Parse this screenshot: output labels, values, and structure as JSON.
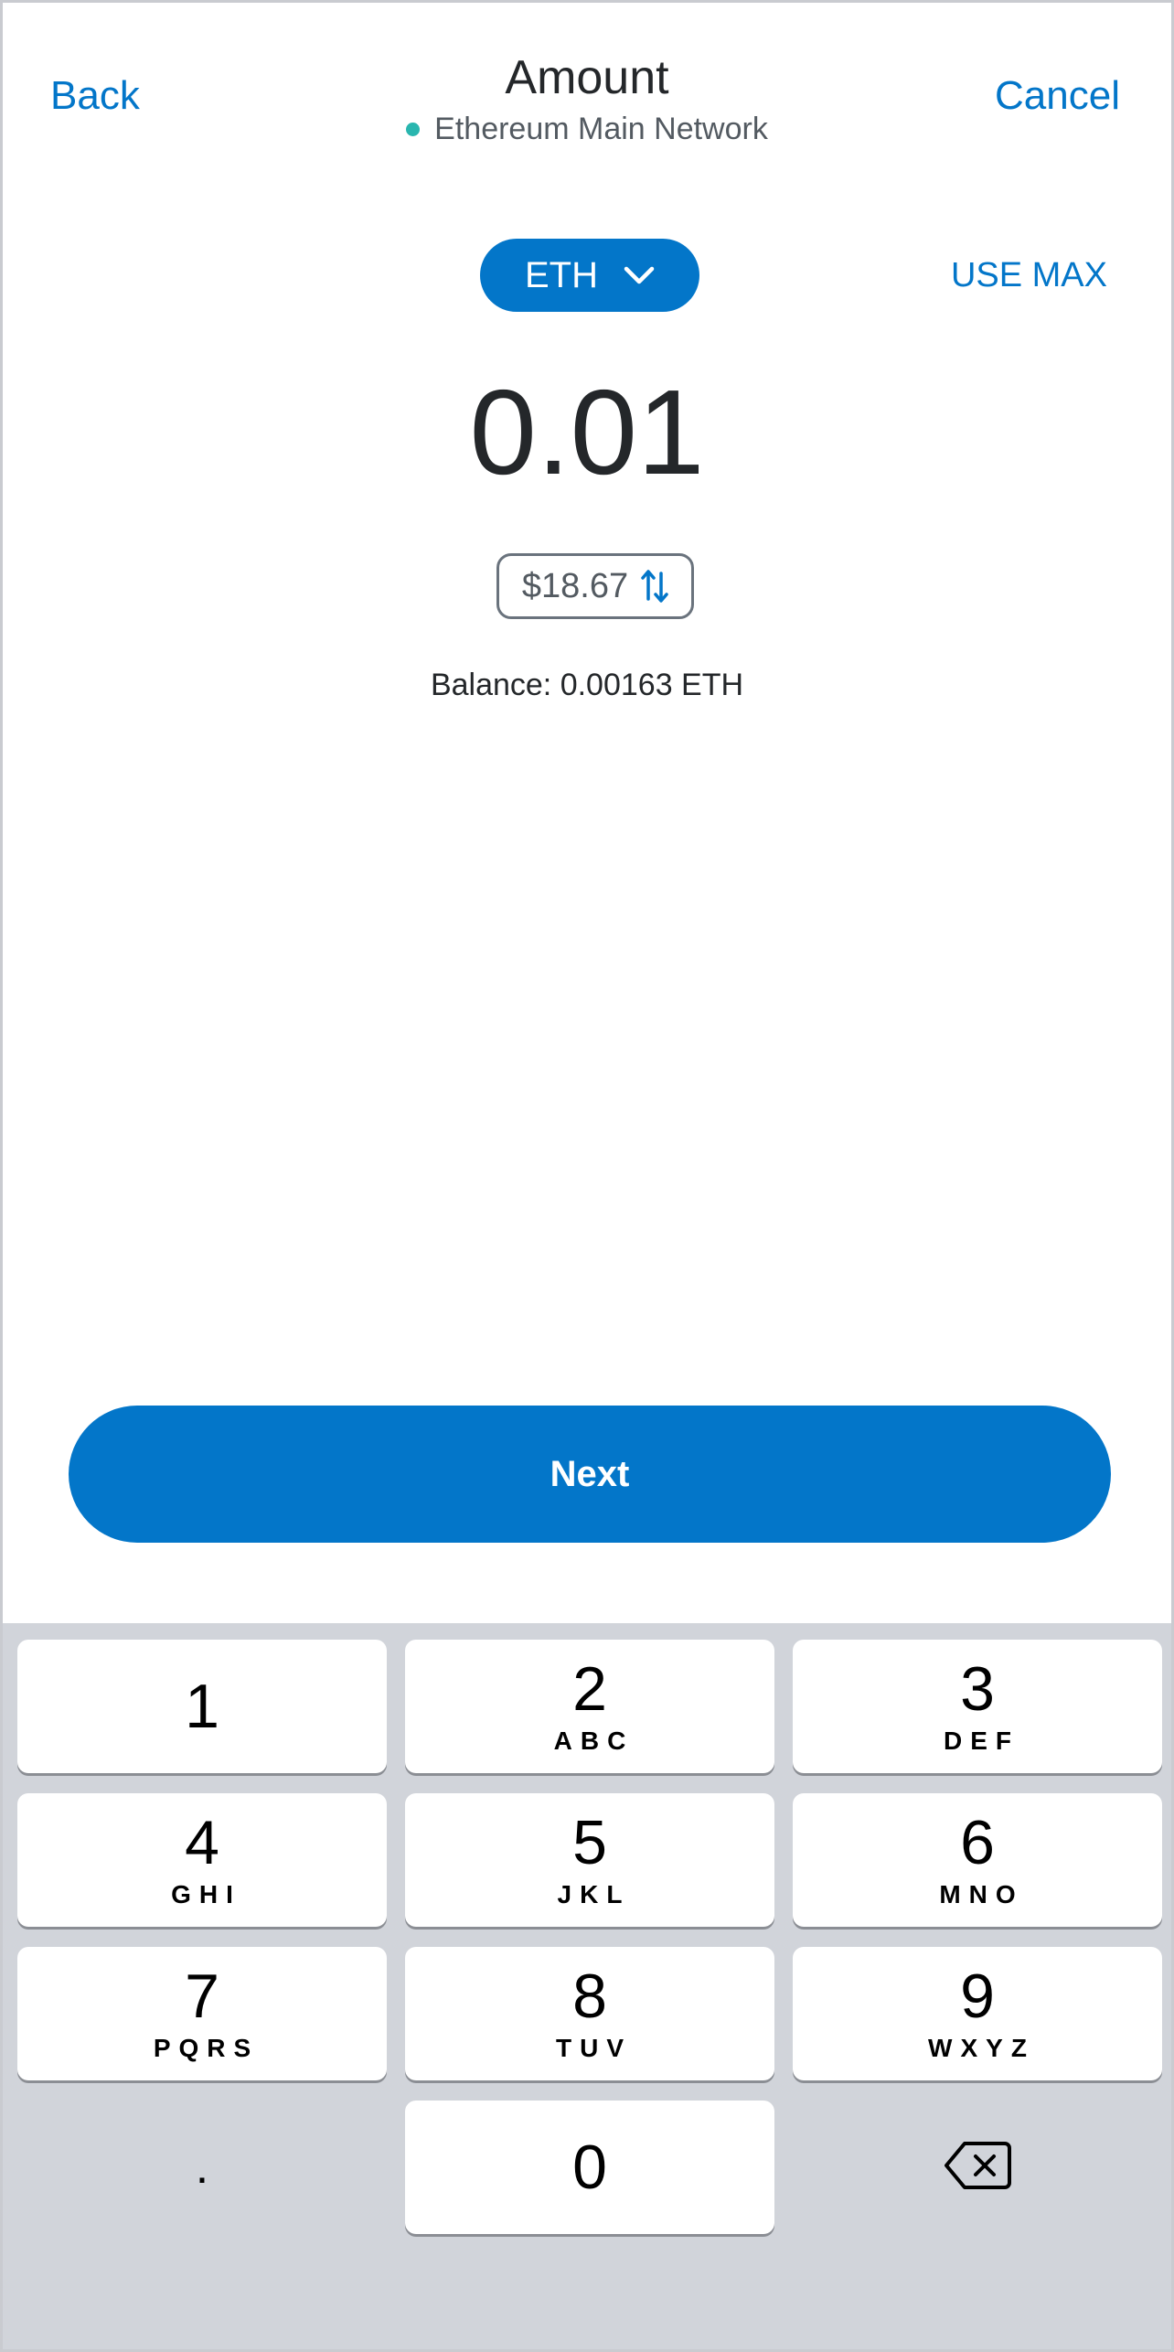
{
  "colors": {
    "accent": "#0376c9",
    "network_dot": "#29b6af",
    "keypad_bg": "#d1d4da"
  },
  "header": {
    "back_label": "Back",
    "title": "Amount",
    "network": "Ethereum Main Network",
    "cancel_label": "Cancel"
  },
  "asset": {
    "symbol": "ETH",
    "icon": "chevron-down-icon",
    "use_max_label": "USE MAX"
  },
  "amount": {
    "value": "0.01",
    "fiat_value": "$18.67",
    "swap_icon": "swap-arrows-icon",
    "balance": "Balance: 0.00163 ETH"
  },
  "next_label": "Next",
  "keypad": {
    "keys": [
      {
        "digit": "1",
        "letters": ""
      },
      {
        "digit": "2",
        "letters": "ABC"
      },
      {
        "digit": "3",
        "letters": "DEF"
      },
      {
        "digit": "4",
        "letters": "GHI"
      },
      {
        "digit": "5",
        "letters": "JKL"
      },
      {
        "digit": "6",
        "letters": "MNO"
      },
      {
        "digit": "7",
        "letters": "PQRS"
      },
      {
        "digit": "8",
        "letters": "TUV"
      },
      {
        "digit": "9",
        "letters": "WXYZ"
      },
      {
        "digit": ".",
        "letters": ""
      },
      {
        "digit": "0",
        "letters": ""
      }
    ],
    "backspace_icon": "backspace-icon"
  }
}
